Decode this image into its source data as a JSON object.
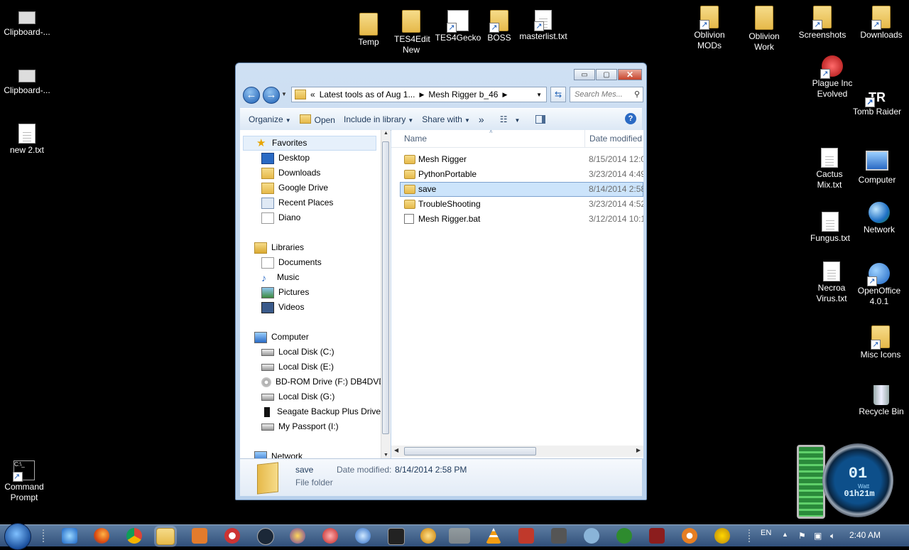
{
  "desktop": {
    "left_icons": [
      {
        "label": "Clipboard-..."
      },
      {
        "label": "Clipboard-..."
      },
      {
        "label": "new  2.txt"
      },
      {
        "label": "Command Prompt"
      }
    ],
    "top_icons": [
      {
        "label": "Temp"
      },
      {
        "label": "TES4Edit New"
      },
      {
        "label": "TES4Gecko"
      },
      {
        "label": "BOSS"
      },
      {
        "label": "masterlist.txt"
      }
    ],
    "right_icons": [
      {
        "label": "Oblivion MODs"
      },
      {
        "label": "Oblivion Work"
      },
      {
        "label": "Screenshots"
      },
      {
        "label": "Downloads"
      },
      {
        "label": "Plague Inc Evolved"
      },
      {
        "label": "Tomb Raider"
      },
      {
        "label": "Cactus Mix.txt"
      },
      {
        "label": "Computer"
      },
      {
        "label": "Fungus.txt"
      },
      {
        "label": "Network"
      },
      {
        "label": "Necroa Virus.txt"
      },
      {
        "label": "OpenOffice 4.0.1"
      },
      {
        "label": "Misc Icons"
      },
      {
        "label": "Recycle Bin"
      }
    ]
  },
  "window": {
    "buttons": {
      "minimize": "▭",
      "maximize": "▢",
      "close": "✕"
    },
    "address": {
      "chevron": "«",
      "segments": [
        "Latest tools as of Aug 1...",
        "Mesh Rigger b_46"
      ]
    },
    "search_placeholder": "Search Mes...",
    "toolbar": {
      "organize": "Organize",
      "open": "Open",
      "include": "Include in library",
      "share": "Share with",
      "more": "»"
    },
    "nav": {
      "favorites": {
        "title": "Favorites",
        "items": [
          "Desktop",
          "Downloads",
          "Google Drive",
          "Recent Places",
          "Diano"
        ]
      },
      "libraries": {
        "title": "Libraries",
        "items": [
          "Documents",
          "Music",
          "Pictures",
          "Videos"
        ]
      },
      "computer": {
        "title": "Computer",
        "items": [
          "Local Disk (C:)",
          "Local Disk (E:)",
          "BD-ROM Drive (F:) DB4DVD",
          "Local Disk (G:)",
          "Seagate Backup Plus Drive (",
          "My Passport (I:)"
        ]
      },
      "network": {
        "title": "Network"
      }
    },
    "columns": {
      "name": "Name",
      "date": "Date modified"
    },
    "files": [
      {
        "name": "Mesh Rigger",
        "date": "8/15/2014 12:0",
        "type": "folder"
      },
      {
        "name": "PythonPortable",
        "date": "3/23/2014 4:49",
        "type": "folder"
      },
      {
        "name": "save",
        "date": "8/14/2014 2:58",
        "type": "folder"
      },
      {
        "name": "TroubleShooting",
        "date": "3/23/2014 4:52",
        "type": "folder"
      },
      {
        "name": "Mesh Rigger.bat",
        "date": "3/12/2014 10:1",
        "type": "bat"
      }
    ],
    "details": {
      "name": "save",
      "date_label": "Date modified:",
      "date_value": "8/14/2014 2:58 PM",
      "type": "File folder"
    }
  },
  "taskbar": {
    "language": "EN",
    "time": "2:40 AM"
  },
  "gadget": {
    "value": "01",
    "unit": "Watt",
    "time": "01h21m"
  }
}
